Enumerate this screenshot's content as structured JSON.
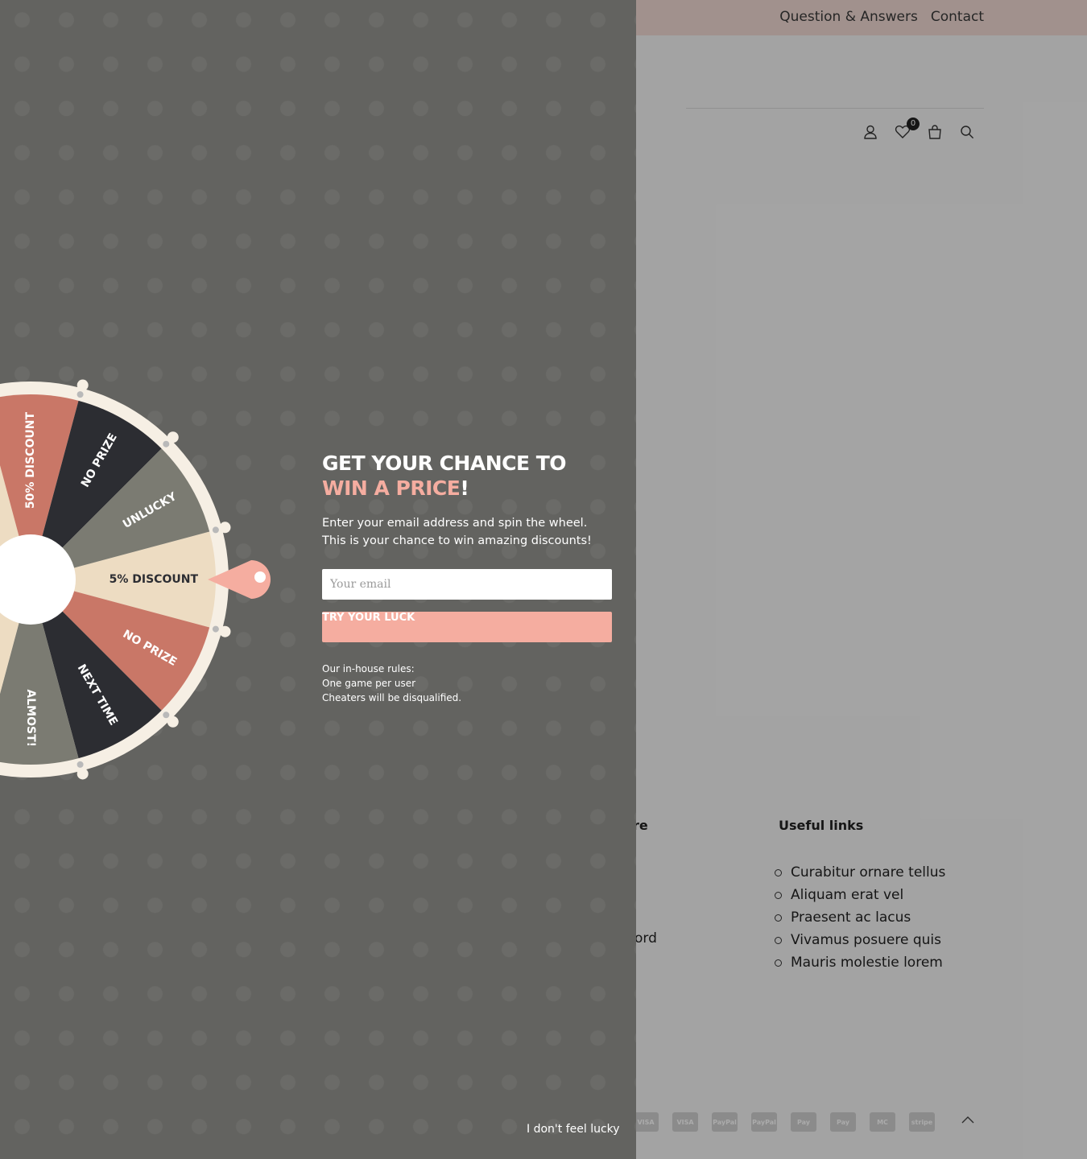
{
  "top_nav": {
    "items": [
      "Question & Answers",
      "Contact"
    ]
  },
  "header": {
    "icons": [
      "user-icon",
      "heart-icon",
      "bag-icon",
      "search-icon"
    ],
    "wishlist_count": "0"
  },
  "footer": {
    "partial_column_title": "re",
    "partial_link": "ord",
    "useful_links": {
      "title": "Useful links",
      "items": [
        "Curabitur ornare tellus",
        "Aliquam erat vel",
        "Praesent ac lacus",
        "Vivamus posuere quis",
        "Mauris molestie lorem"
      ]
    },
    "payments": [
      "VISA",
      "VISA",
      "PayPal",
      "PayPal",
      "Pay",
      "Pay",
      "MC",
      "stripe"
    ]
  },
  "popup": {
    "title_part1": "GET YOUR CHANCE TO ",
    "title_accent": "WIN A PRICE",
    "title_end": "!",
    "subtitle": "Enter your email address and spin the wheel. This is your chance to win amazing discounts!",
    "email_placeholder": "Your email",
    "try_button": "TRY YOUR LUCK",
    "rules": [
      "Our in-house rules:",
      "One game per user",
      "Cheaters will be disqualified."
    ],
    "dismiss": "I don't feel lucky"
  },
  "wheel": {
    "segments": [
      {
        "label": "5% DISCOUNT",
        "color": "#eddcc2"
      },
      {
        "label": "NO PRIZE",
        "color": "#c97767"
      },
      {
        "label": "NEXT TIME",
        "color": "#2c2d32"
      },
      {
        "label": "ALMOST!",
        "color": "#7b7b72"
      },
      {
        "label": "",
        "color": "#eddcc2"
      },
      {
        "label": "",
        "color": "#c97767"
      },
      {
        "label": "",
        "color": "#2c2d32"
      },
      {
        "label": "",
        "color": "#7b7b72"
      },
      {
        "label": "",
        "color": "#eddcc2"
      },
      {
        "label": "50% DISCOUNT",
        "color": "#c97767"
      },
      {
        "label": "NO PRIZE",
        "color": "#2c2d32"
      },
      {
        "label": "UNLUCKY",
        "color": "#7b7b72"
      }
    ],
    "rim_color": "#f6efe4",
    "pointer_color": "#f5ada0"
  },
  "colors": {
    "accent": "#f5ada0",
    "panel_bg": "#636360",
    "top_bar": "#f1d9d2"
  }
}
